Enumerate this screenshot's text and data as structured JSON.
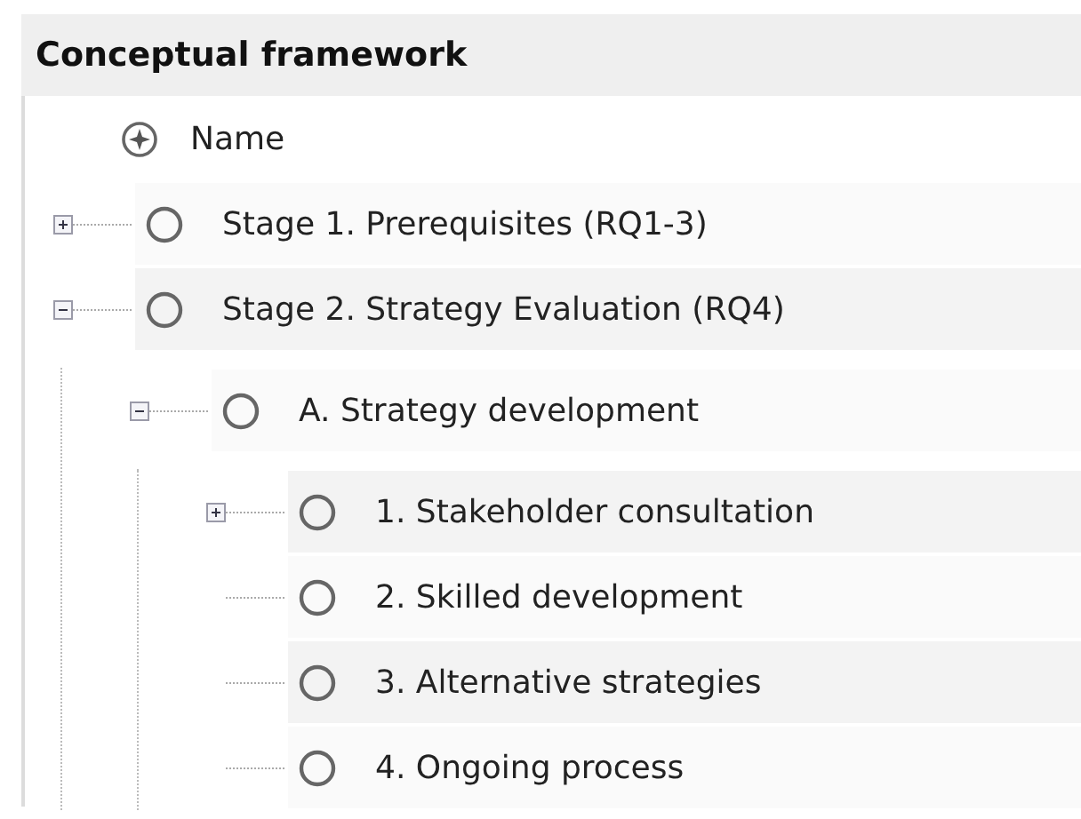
{
  "panel": {
    "title": "Conceptual framework"
  },
  "tree": {
    "header": "Name",
    "items": [
      {
        "label": "Stage 1. Prerequisites (RQ1-3)",
        "expanded": false
      },
      {
        "label": "Stage 2. Strategy Evaluation (RQ4)",
        "expanded": true,
        "children": [
          {
            "label": "A. Strategy development",
            "expanded": true,
            "children": [
              {
                "label": "1. Stakeholder consultation",
                "expanded": false
              },
              {
                "label": "2. Skilled development"
              },
              {
                "label": "3. Alternative strategies"
              },
              {
                "label": "4. Ongoing process"
              }
            ]
          }
        ]
      }
    ]
  }
}
